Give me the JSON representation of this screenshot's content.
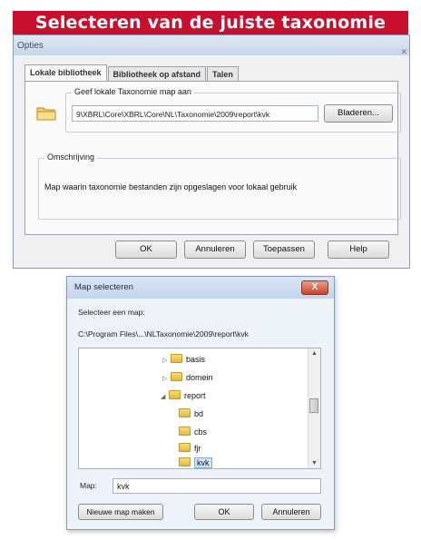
{
  "banner": {
    "title": "Selecteren van de juiste taxonomie"
  },
  "opties": {
    "title": "Opties",
    "tabs": [
      "Lokale bibliotheek",
      "Bibliotheek op afstand",
      "Talen"
    ],
    "group_folder_label": "Geef lokale Taxonomie map aan",
    "path_value": "9\\XBRL\\Core\\XBRL\\Core\\NL\\Taxonomie\\2009\\report\\kvk",
    "browse_label": "Bladeren...",
    "group_desc_label": "Omschrijving",
    "description": "Map waarin taxonomie bestanden zijn opgeslagen voor lokaal gebruik",
    "buttons": {
      "ok": "OK",
      "cancel": "Annuleren",
      "apply": "Toepassen",
      "help": "Help"
    }
  },
  "map_dialog": {
    "title": "Map selecteren",
    "close_label": "X",
    "prompt": "Selecteer een map:",
    "current_path": "C:\\Program Files\\...\\NLTaxonomie\\2009\\report\\kvk",
    "tree": [
      {
        "label": "basis",
        "expanded": false
      },
      {
        "label": "domein",
        "expanded": false
      },
      {
        "label": "report",
        "expanded": true
      },
      {
        "label": "bd"
      },
      {
        "label": "cbs"
      },
      {
        "label": "fjr"
      },
      {
        "label": "kvk",
        "selected": true
      }
    ],
    "map_label": "Map:",
    "map_value": "kvk",
    "buttons": {
      "new_folder": "Nieuwe map maken",
      "ok": "OK",
      "cancel": "Annuleren"
    }
  }
}
